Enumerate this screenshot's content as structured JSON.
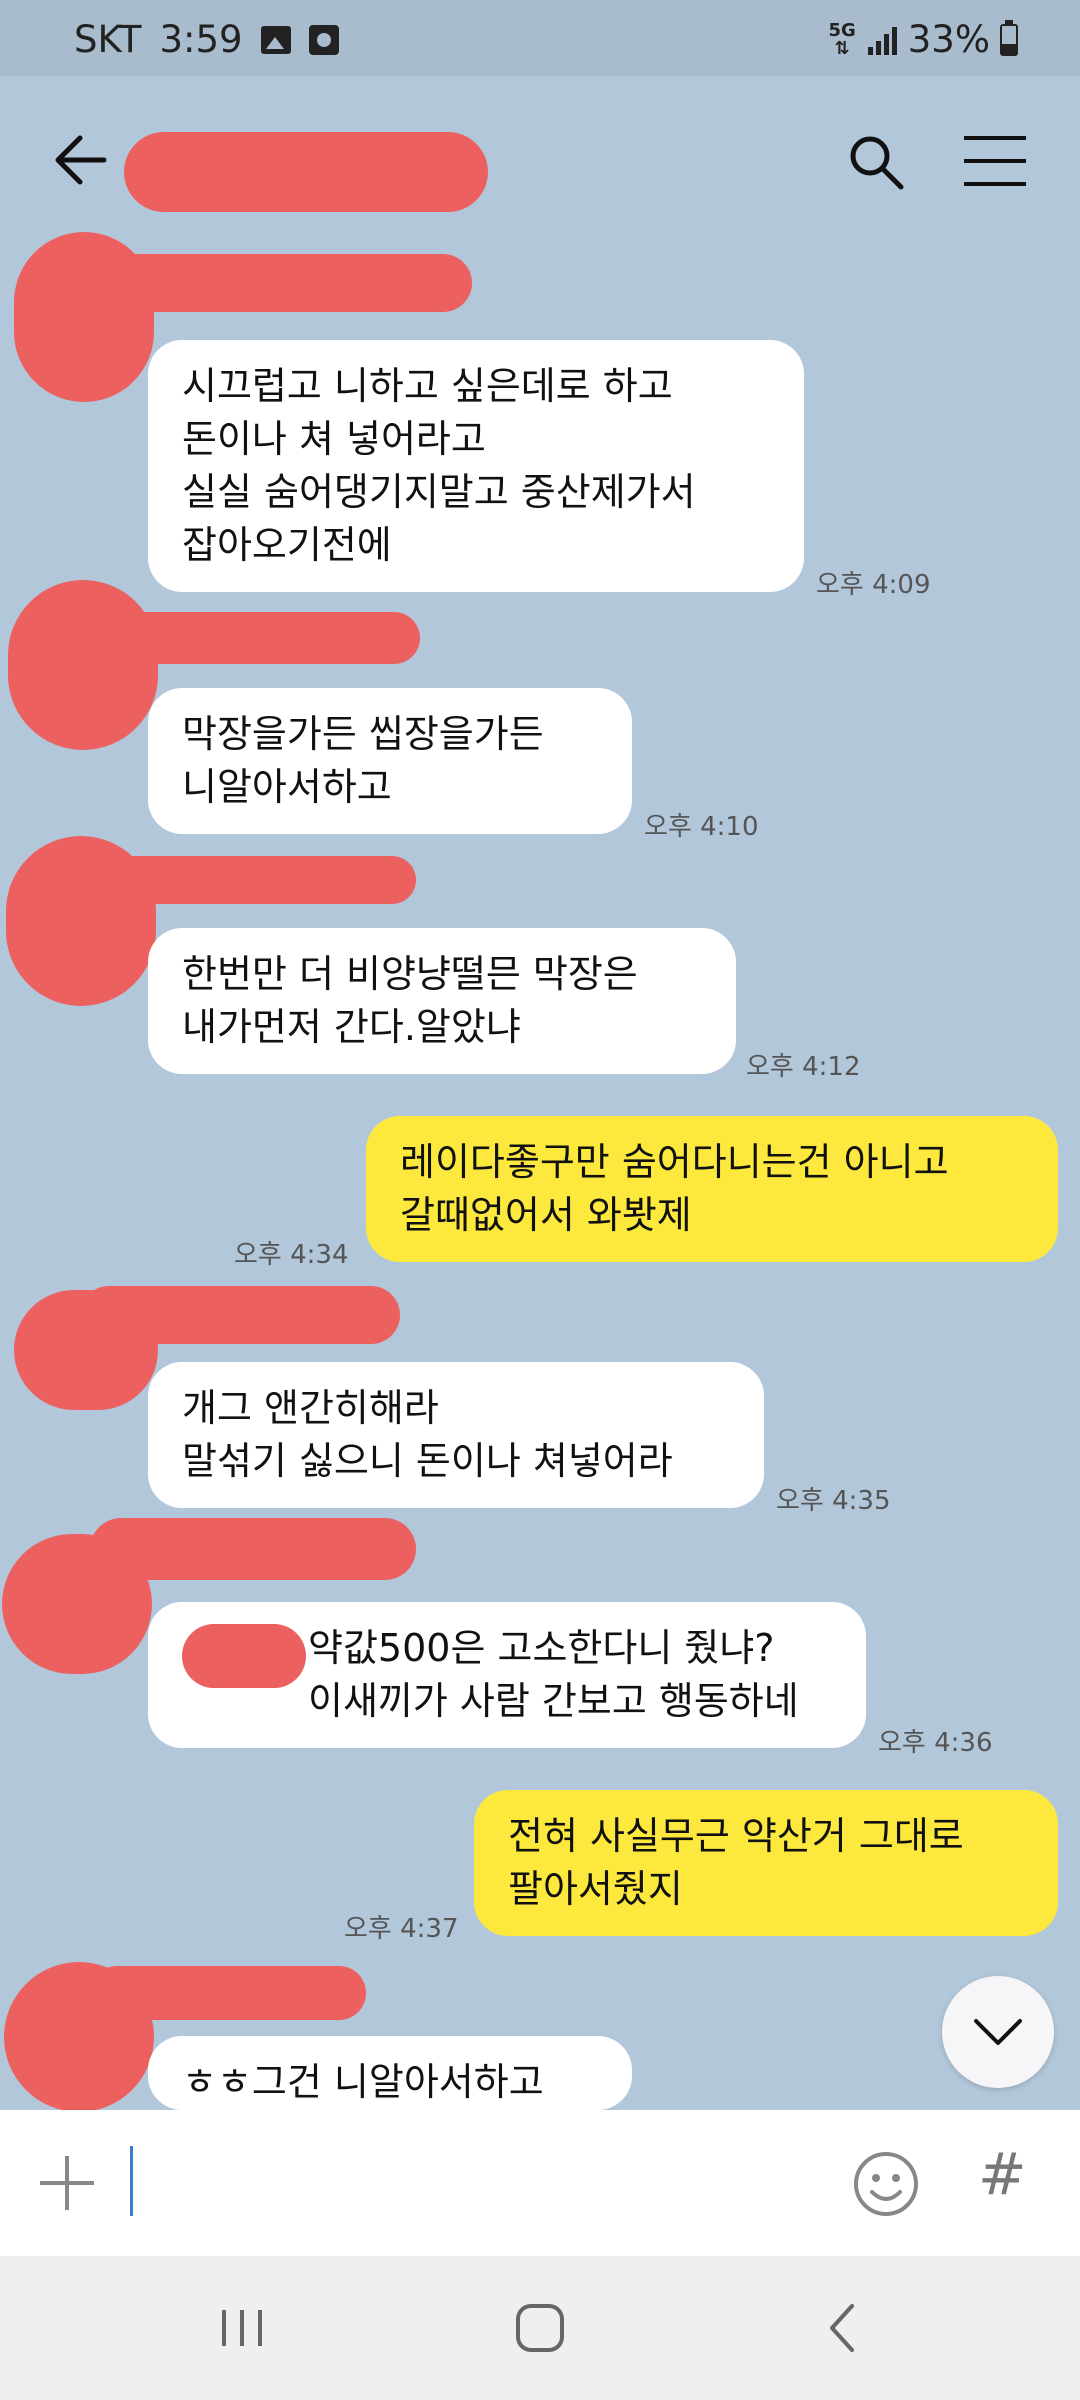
{
  "status_bar": {
    "carrier": "SKT",
    "time": "3:59",
    "network": "5G",
    "battery": "33%"
  },
  "icons": {
    "back": "arrow-left-icon",
    "search": "search-icon",
    "menu": "hamburger-menu-icon",
    "plus": "plus-icon",
    "emoji": "smiley-icon",
    "hash": "hash-icon",
    "scroll": "chevron-down-icon"
  },
  "colors": {
    "chat_bg": "#b2c7da",
    "incoming_bubble": "#ffffff",
    "outgoing_bubble": "#fde93d",
    "redaction": "#ec6060"
  },
  "messages": [
    {
      "dir": "in",
      "text": "시끄럽고 니하고 싶은데로 하고\n돈이나 쳐 넣어라고\n실실 숨어댕기지말고 중산제가서\n잡아오기전에",
      "time": "오후 4:09"
    },
    {
      "dir": "in",
      "text": "막장을가든 씹장을가든\n니알아서하고",
      "time": "오후 4:10"
    },
    {
      "dir": "in",
      "text": "한번만 더 비양냥떨믄 막장은\n내가먼저 간다.알았냐",
      "time": "오후 4:12"
    },
    {
      "dir": "out",
      "text": "레이다좋구만 숨어다니는건 아니고\n갈때없어서 와봣제",
      "time": "오후 4:34"
    },
    {
      "dir": "in",
      "text": "개그 앤간히해라\n말섞기 싫으니 돈이나 쳐넣어라",
      "time": "오후 4:35"
    },
    {
      "dir": "in",
      "text": "약값500은 고소한다니 줬냐?\n이새끼가 사람 간보고 행동하네",
      "time": "오후 4:36"
    },
    {
      "dir": "out",
      "text": "전혀 사실무근 약산거 그대로\n팔아서줬지",
      "time": "오후 4:37"
    },
    {
      "dir": "in",
      "text": "ㅎㅎ그건 니알아서하고",
      "time": ""
    }
  ],
  "input": {
    "value": ""
  }
}
